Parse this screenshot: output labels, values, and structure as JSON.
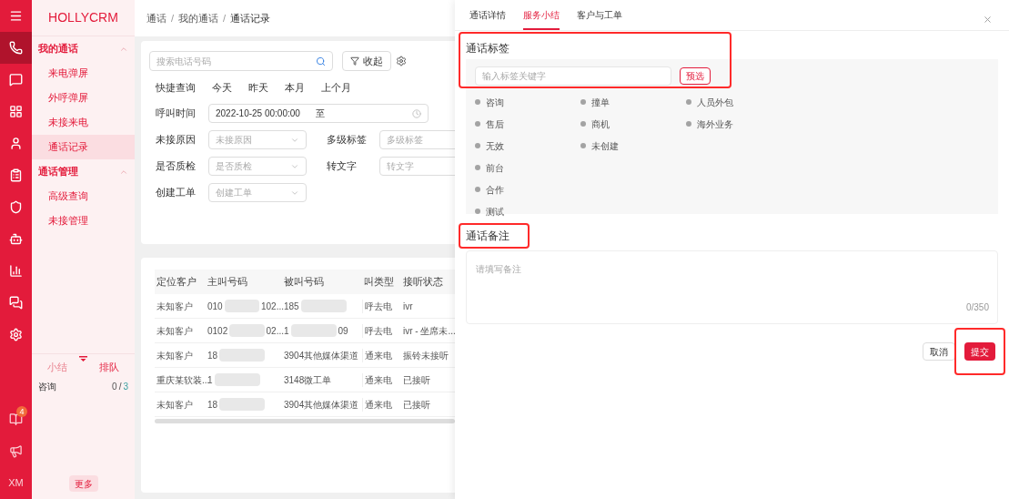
{
  "rail": {
    "items": [
      {
        "selected": false
      },
      {
        "selected": true
      },
      {
        "selected": false
      },
      {
        "selected": false
      },
      {
        "selected": false
      },
      {
        "selected": false
      },
      {
        "selected": false
      },
      {
        "selected": false
      },
      {
        "selected": false
      },
      {
        "selected": false
      },
      {
        "selected": false
      }
    ],
    "bottom": {
      "badge": "4",
      "user": "XM"
    }
  },
  "nav": {
    "logo": "HOLLYCRM",
    "groups": [
      {
        "label": "我的通话",
        "expanded": true,
        "items": [
          {
            "label": "来电弹屏",
            "selected": false
          },
          {
            "label": "外呼弹屏",
            "selected": false
          },
          {
            "label": "未接来电",
            "selected": false
          },
          {
            "label": "通话记录",
            "selected": true
          }
        ]
      },
      {
        "label": "通话管理",
        "expanded": true,
        "items": [
          {
            "label": "高级查询",
            "selected": false
          },
          {
            "label": "未接管理",
            "selected": false
          }
        ]
      }
    ],
    "queue_tabs": [
      {
        "label": "小结",
        "selected": false
      },
      {
        "label": "排队",
        "selected": true
      }
    ],
    "queue_rows": [
      {
        "name": "咨询",
        "count": "0",
        "separator": "/",
        "total": "3"
      }
    ],
    "more_button": "更多"
  },
  "breadcrumb": [
    {
      "kind": "link",
      "text": "通话"
    },
    {
      "kind": "separator",
      "text": "/"
    },
    {
      "kind": "link",
      "text": "我的通话"
    },
    {
      "kind": "separator",
      "text": "/"
    },
    {
      "kind": "current",
      "text": "通话记录"
    }
  ],
  "filters": {
    "search_placeholder": "搜索电话号码",
    "collapse_button": "收起",
    "quick_label": "快捷查询",
    "quick_options": [
      "今天",
      "昨天",
      "本月",
      "上个月"
    ],
    "time_label": "呼叫时间",
    "time_start": "2022-10-25 00:00:00",
    "time_sep": "至",
    "rows": [
      [
        {
          "label": "未接原因",
          "placeholder": "未接原因",
          "kind": "select"
        },
        {
          "label": "多级标签",
          "placeholder": "多级标签",
          "kind": "text"
        }
      ],
      [
        {
          "label": "是否质检",
          "placeholder": "是否质检",
          "kind": "select"
        },
        {
          "label": "转文字",
          "placeholder": "转文字",
          "kind": "text"
        }
      ],
      [
        {
          "label": "创建工单",
          "placeholder": "创建工单",
          "kind": "select"
        }
      ]
    ]
  },
  "table": {
    "columns": [
      "定位客户",
      "主叫号码",
      "被叫号码",
      "叫类型",
      "接听状态"
    ],
    "rows": [
      {
        "customer": "未知客户",
        "caller": {
          "start": "010",
          "end": "102..."
        },
        "callee": {
          "start": "185"
        },
        "type": "呼去电",
        "status": "ivr"
      },
      {
        "customer": "未知客户",
        "caller": {
          "start": "0102",
          "end": "02..."
        },
        "callee": {
          "start": "1",
          "end": "09"
        },
        "type": "呼去电",
        "status": "ivr - 坐席未..."
      },
      {
        "customer": "未知客户",
        "caller": {
          "start": "18"
        },
        "callee": {
          "start": "3904其他媒体渠道"
        },
        "type": "通来电",
        "status": "振铃未接听"
      },
      {
        "customer": "重庆某软装...",
        "caller": {
          "start": "1"
        },
        "callee": {
          "start": "3148微工单"
        },
        "type": "通来电",
        "status": "已接听"
      },
      {
        "customer": "未知客户",
        "caller": {
          "start": "18"
        },
        "callee": {
          "start": "3904其他媒体渠道"
        },
        "type": "通来电",
        "status": "已接听"
      }
    ]
  },
  "drawer": {
    "tabs": [
      {
        "label": "通话详情",
        "selected": false
      },
      {
        "label": "服务小结",
        "selected": true
      },
      {
        "label": "客户与工单",
        "selected": false
      }
    ],
    "tags": {
      "title": "通话标签",
      "highlighted": true,
      "search_placeholder": "输入标签关键字",
      "preselect_button": "预选",
      "columns": [
        [
          "咨询",
          "售后",
          "无效",
          "前台",
          "合作",
          "测试"
        ],
        [
          "撞单",
          "商机",
          "未创建"
        ],
        [
          "人员外包",
          "海外业务"
        ]
      ]
    },
    "note": {
      "title": "通话备注",
      "highlighted": true,
      "placeholder": "请填写备注",
      "counter": "0/350"
    },
    "cancel_button": "取消",
    "submit_button": "提交",
    "submit_highlighted": true
  }
}
